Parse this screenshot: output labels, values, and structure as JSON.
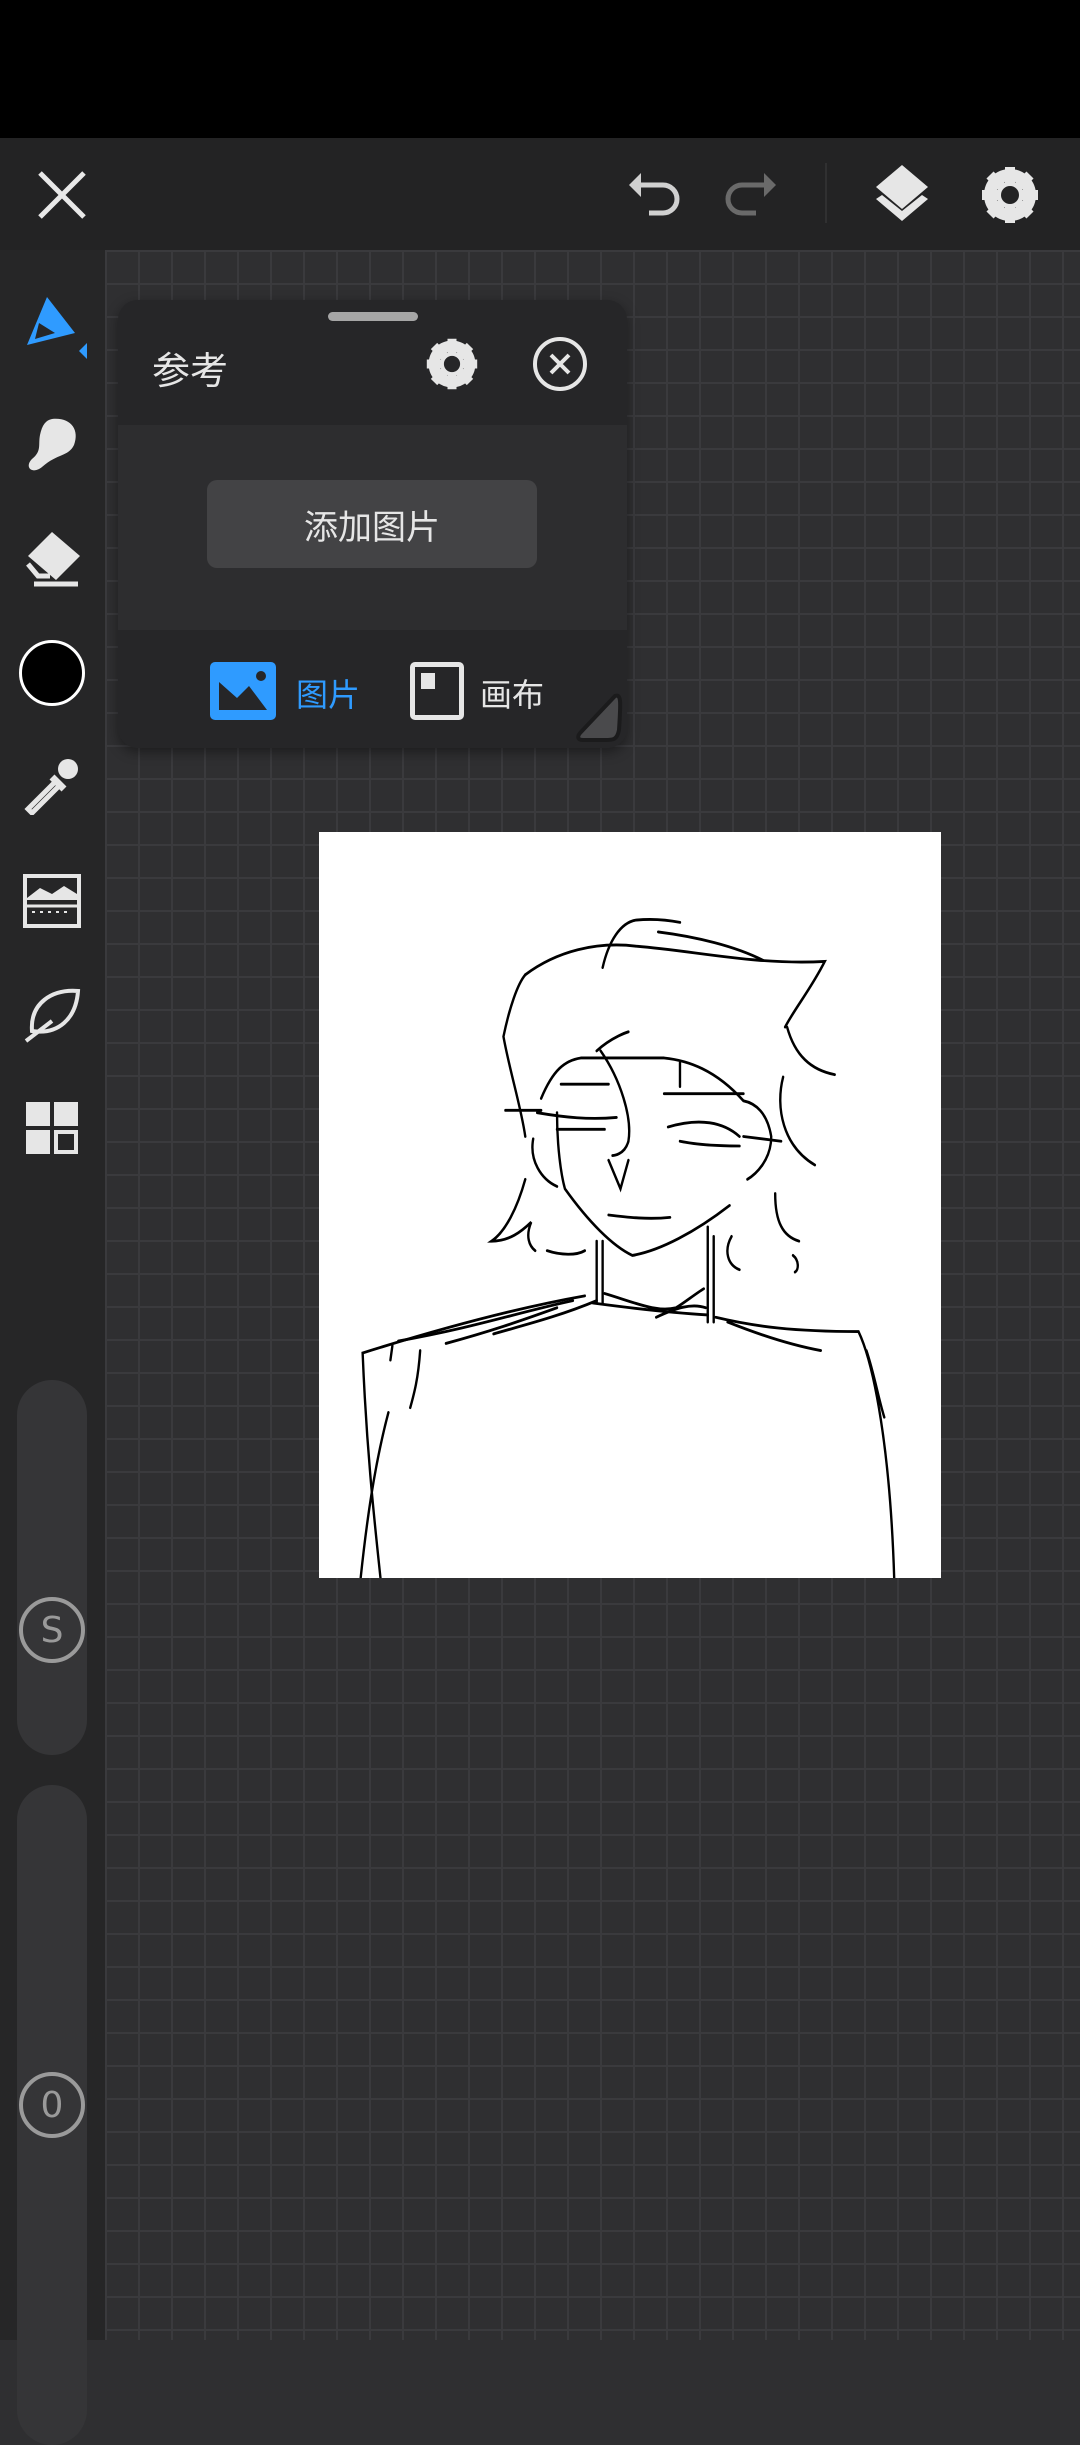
{
  "reference_panel": {
    "title": "参考",
    "add_image_label": "添加图片",
    "tabs": [
      {
        "label": "图片",
        "active": true
      },
      {
        "label": "画布",
        "active": false
      }
    ]
  },
  "sliders": {
    "size_label": "S",
    "opacity_label": "0"
  },
  "colors": {
    "accent": "#2f9bff",
    "current_color": "#000000"
  }
}
